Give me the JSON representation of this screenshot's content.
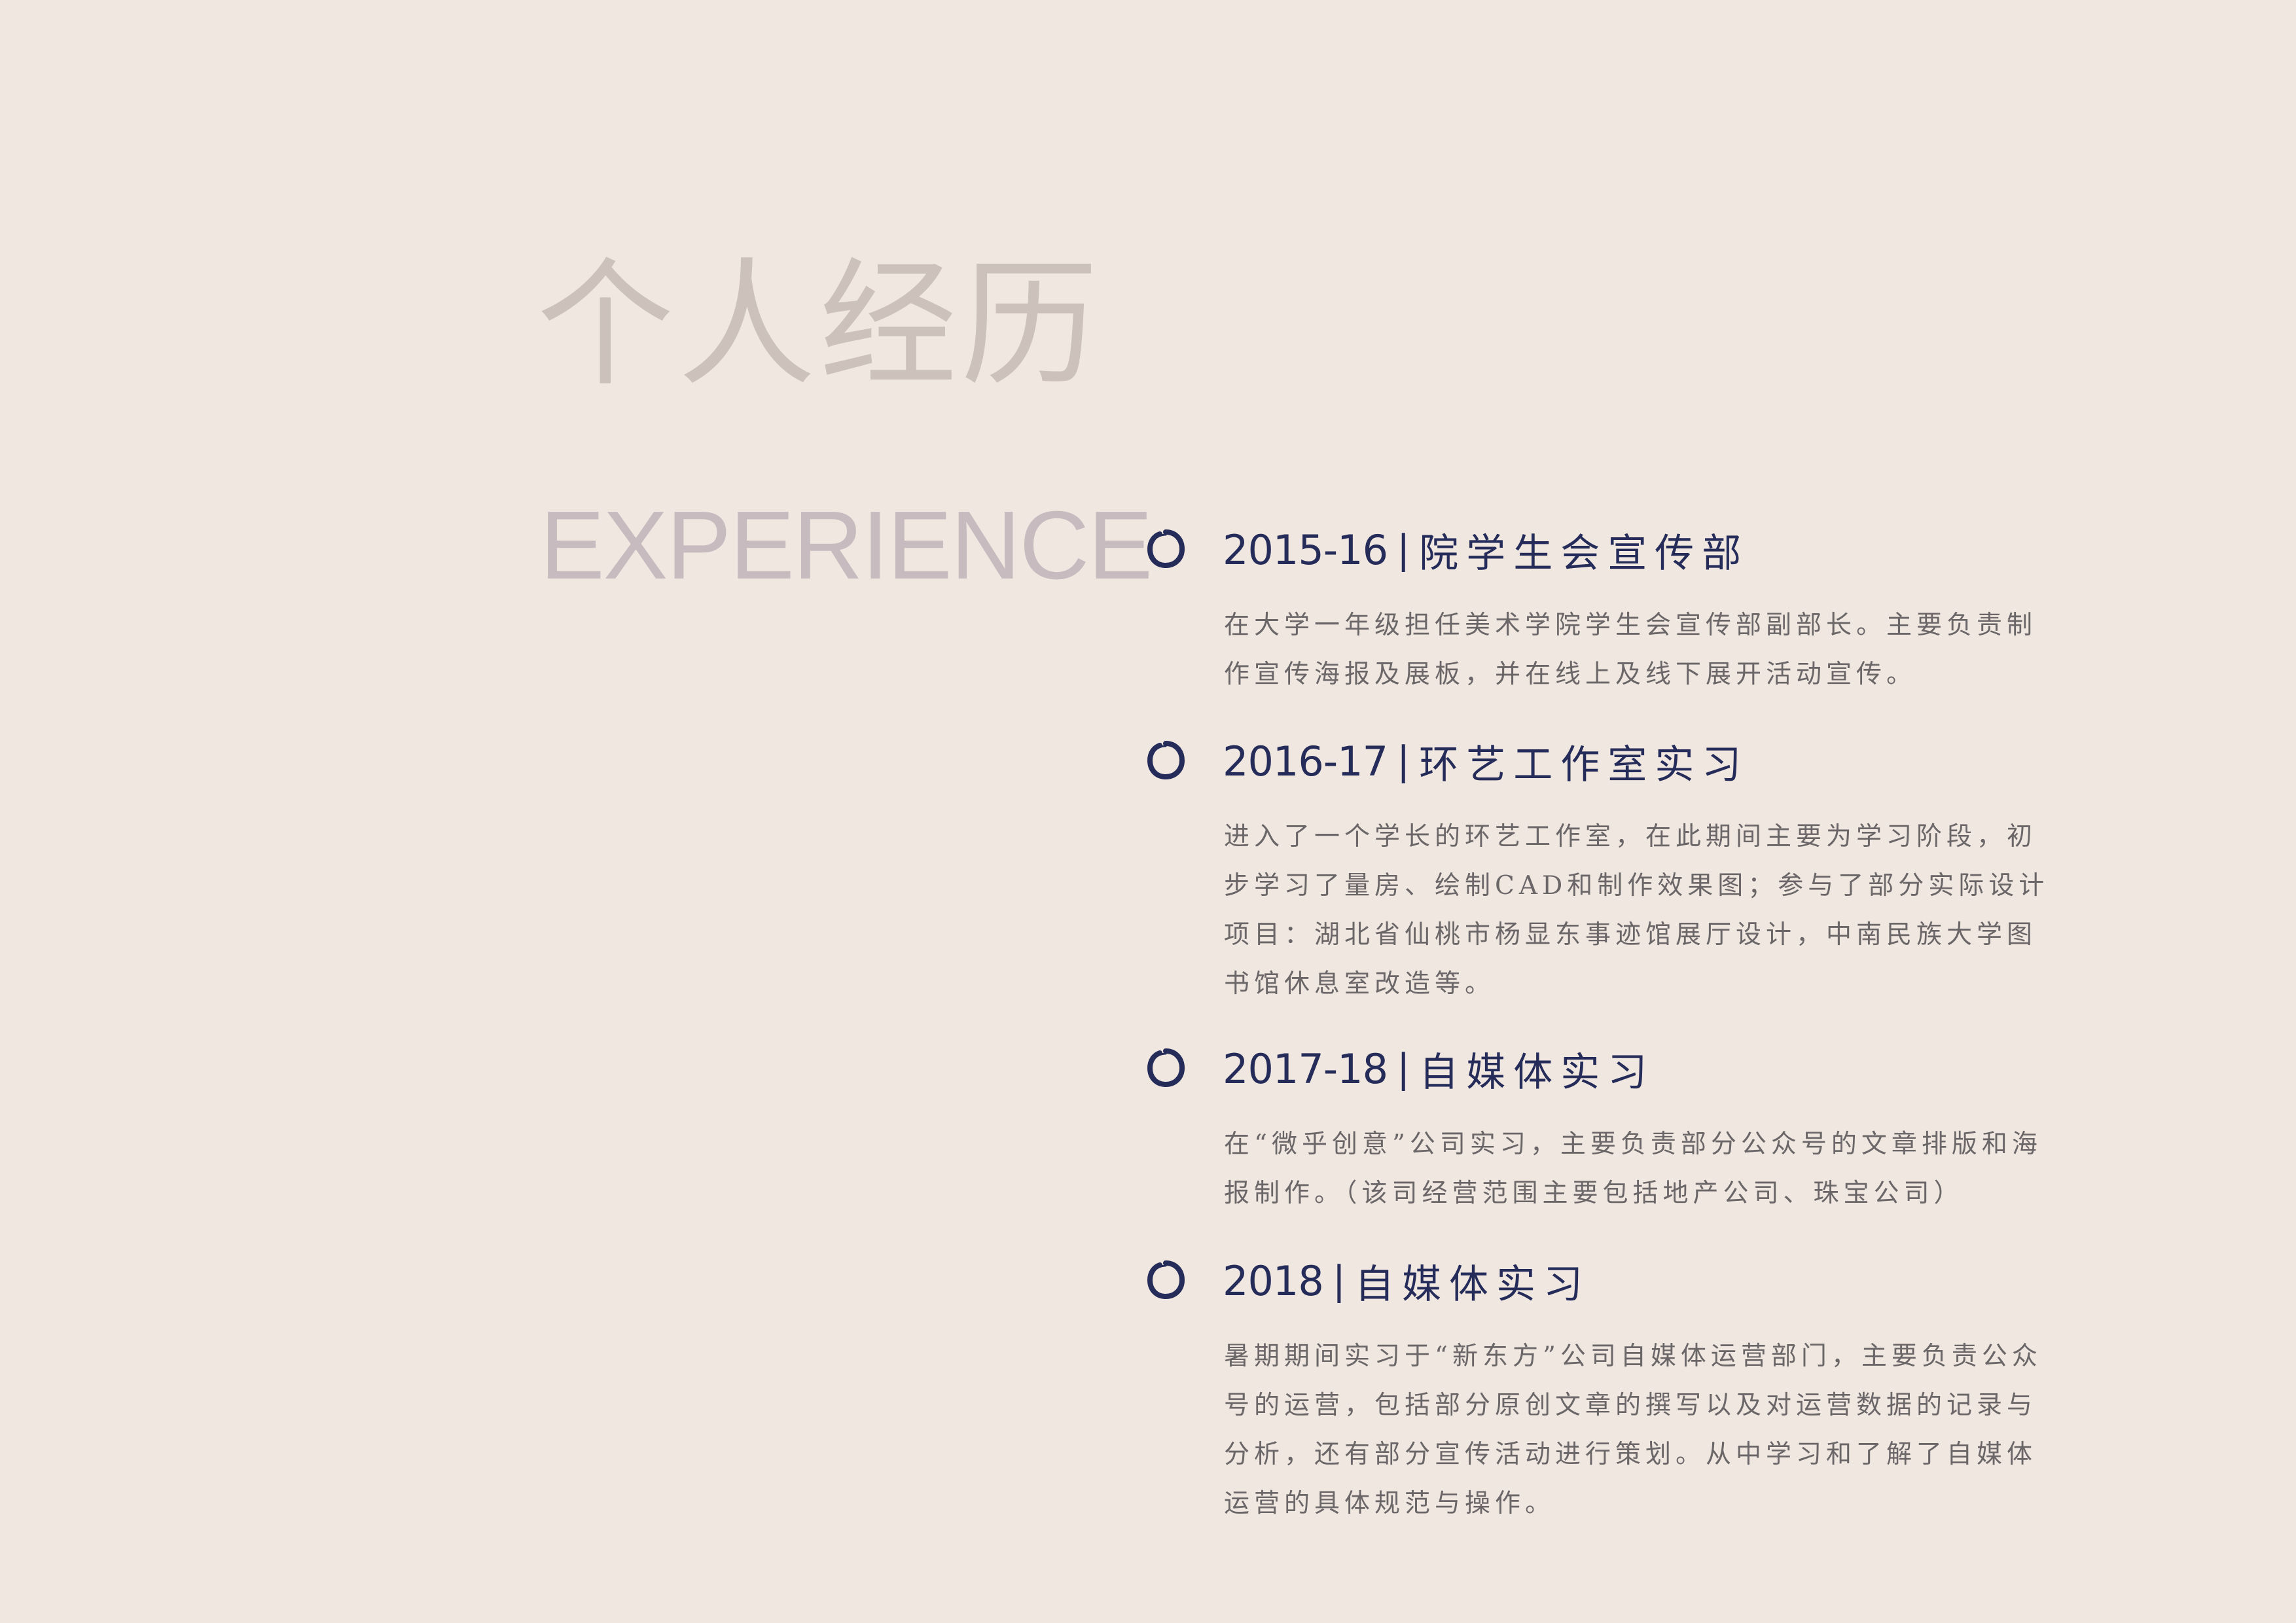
{
  "header": {
    "title_cn": "个人经历",
    "title_en": "EXPERIENCE"
  },
  "colors": {
    "background": "#efe7e0",
    "title_cn": "#cdc1bc",
    "title_en": "#c7bbbf",
    "heading": "#252c59",
    "body": "#6b6668"
  },
  "experience": [
    {
      "year": "2015-16",
      "separator": "|",
      "role": "院学生会宣传部",
      "description": "在大学一年级担任美术学院学生会宣传部副部长。主要负责制作宣传海报及展板，并在线上及线下展开活动宣传。"
    },
    {
      "year": "2016-17",
      "separator": "|",
      "role": "环艺工作室实习",
      "description": "进入了一个学长的环艺工作室，在此期间主要为学习阶段，初步学习了量房、绘制CAD和制作效果图；参与了部分实际设计项目：湖北省仙桃市杨显东事迹馆展厅设计，中南民族大学图书馆休息室改造等。"
    },
    {
      "year": "2017-18",
      "separator": "|",
      "role": "自媒体实习",
      "description": "在“微乎创意”公司实习，主要负责部分公众号的文章排版和海报制作。（该司经营范围主要包括地产公司、珠宝公司）"
    },
    {
      "year": "2018",
      "separator": "|",
      "role": "自媒体实习",
      "description": "暑期期间实习于“新东方”公司自媒体运营部门，主要负责公众号的运营，包括部分原创文章的撰写以及对运营数据的记录与分析，还有部分宣传活动进行策划。从中学习和了解了自媒体运营的具体规范与操作。"
    }
  ]
}
